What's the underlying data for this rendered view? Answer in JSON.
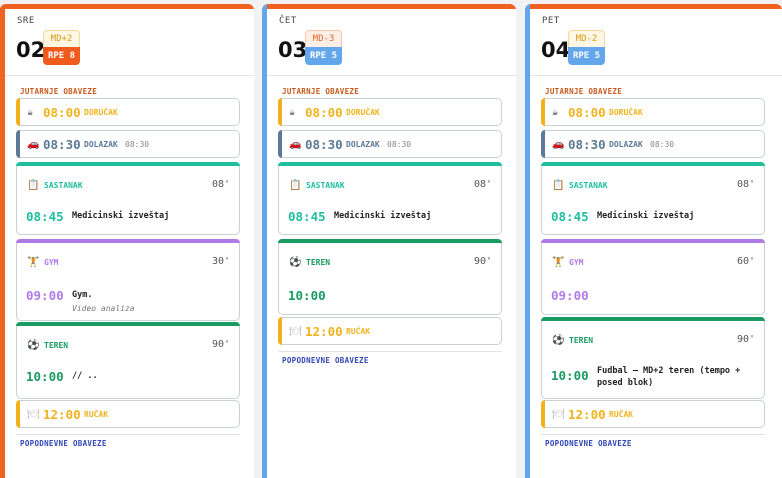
{
  "days": [
    {
      "dayname": "SRE",
      "daynum": "02",
      "md": "MD+2",
      "rpe": "RPE 8",
      "morning_title": "JUTARNJE OBAVEZE",
      "afternoon_title": "POPODNEVNE OBAVEZE",
      "breakfast": {
        "time": "08:00",
        "label": "DORUČAK"
      },
      "arrival": {
        "time": "08:30",
        "label": "DOLAZAK",
        "sub": "08:30"
      },
      "meeting": {
        "category": "SASTANAK",
        "duration": "08'",
        "time": "08:45",
        "title": "Medicinski izveštaj"
      },
      "gym": {
        "category": "GYM",
        "duration": "30'",
        "time": "09:00",
        "title": "Gym.",
        "note": "Video analiza"
      },
      "field": {
        "category": "TEREN",
        "duration": "90'",
        "time": "10:00",
        "title": "// .."
      },
      "lunch": {
        "time": "12:00",
        "label": "RUČAK"
      }
    },
    {
      "dayname": "ČET",
      "daynum": "03",
      "md": "MD-3",
      "rpe": "RPE 5",
      "morning_title": "JUTARNJE OBAVEZE",
      "afternoon_title": "POPODNEVNE OBAVEZE",
      "breakfast": {
        "time": "08:00",
        "label": "DORUČAK"
      },
      "arrival": {
        "time": "08:30",
        "label": "DOLAZAK",
        "sub": "08:30"
      },
      "meeting": {
        "category": "SASTANAK",
        "duration": "08'",
        "time": "08:45",
        "title": "Medicinski izveštaj"
      },
      "field": {
        "category": "TEREN",
        "duration": "90'",
        "time": "10:00"
      },
      "lunch": {
        "time": "12:00",
        "label": "RUČAK"
      }
    },
    {
      "dayname": "PET",
      "daynum": "04",
      "md": "MD-2",
      "rpe": "RPE 5",
      "morning_title": "JUTARNJE OBAVEZE",
      "afternoon_title": "POPODNEVNE OBAVEZE",
      "breakfast": {
        "time": "08:00",
        "label": "DORUČAK"
      },
      "arrival": {
        "time": "08:30",
        "label": "DOLAZAK",
        "sub": "08:30"
      },
      "meeting": {
        "category": "SASTANAK",
        "duration": "08'",
        "time": "08:45",
        "title": "Medicinski izveštaj"
      },
      "gym": {
        "category": "GYM",
        "duration": "60'",
        "time": "09:00"
      },
      "field": {
        "category": "TEREN",
        "duration": "90'",
        "time": "10:00",
        "title_line1": "Fudbal – MD+2 teren (tempo +",
        "title_line2": "posed blok)"
      },
      "lunch": {
        "time": "12:00",
        "label": "RUČAK"
      }
    }
  ],
  "icons": {
    "breakfast": "coffee-icon",
    "arrival": "car-icon",
    "meeting": "clipboard-icon",
    "gym": "dumbbell-icon",
    "field": "soccer-ball-icon",
    "lunch": "plate-icon"
  },
  "colors": {
    "orange": "#f0621f",
    "blue": "#64a6ec",
    "gold": "#f0b31e",
    "slate": "#5c7a96",
    "teal": "#1fbf9e",
    "purple": "#b07be8",
    "green": "#1a9b62",
    "section_orange": "#c75a1c",
    "section_blue": "#3347b5"
  }
}
